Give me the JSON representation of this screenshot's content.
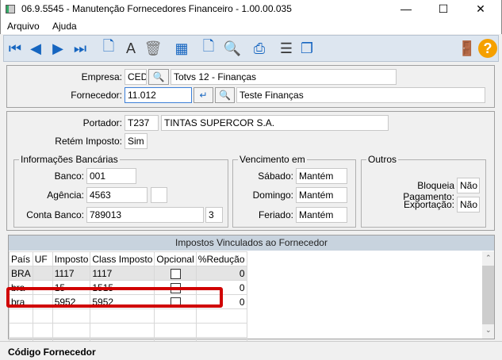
{
  "window": {
    "title": "06.9.5545 - Manutenção Fornecedores Financeiro - 1.00.00.035",
    "minimize": "—",
    "maximize": "☐",
    "close": "✕"
  },
  "menu": [
    "Arquivo",
    "Ajuda"
  ],
  "toolbar": [
    "first-icon",
    "previous-icon",
    "next-icon",
    "last-icon",
    "new-icon",
    "edit-icon",
    "delete-icon",
    "grid-icon",
    "blank-page-icon",
    "preview-icon",
    "print-icon",
    "filter-icon",
    "copy-icon",
    "exit-icon",
    "help-icon"
  ],
  "empresa": {
    "label": "Empresa:",
    "code": "CED",
    "name": "Totvs 12 - Finanças"
  },
  "fornecedor": {
    "label": "Fornecedor:",
    "code": "11.012",
    "name": "Teste Finanças"
  },
  "portador": {
    "label": "Portador:",
    "code": "T237",
    "name": "TINTAS SUPERCOR S.A."
  },
  "retem": {
    "label": "Retém Imposto:",
    "value": "Sim"
  },
  "bancarias": {
    "title": "Informações Bancárias",
    "banco_label": "Banco:",
    "banco": "001",
    "agencia_label": "Agência:",
    "agencia": "4563",
    "agencia_dv": "",
    "conta_label": "Conta Banco:",
    "conta": "789013",
    "conta_dv": "3"
  },
  "vencimento": {
    "title": "Vencimento em",
    "sabado_label": "Sábado:",
    "sabado": "Mantém",
    "domingo_label": "Domingo:",
    "domingo": "Mantém",
    "feriado_label": "Feriado:",
    "feriado": "Mantém"
  },
  "outros": {
    "title": "Outros",
    "bloqueia_label": "Bloqueia Pagamento:",
    "bloqueia": "Não",
    "exportacao_label": "Exportação:",
    "exportacao": "Não"
  },
  "grid": {
    "title": "Impostos Vinculados ao Fornecedor",
    "columns": [
      "País",
      "UF",
      "Imposto",
      "Class Imposto",
      "Opcional",
      "%Redução"
    ],
    "rows": [
      [
        "BRA",
        "",
        "1117",
        "1117",
        false,
        "0"
      ],
      [
        "bra",
        "",
        "15",
        "1515",
        false,
        "0"
      ],
      [
        "bra",
        "",
        "5952",
        "5952",
        false,
        "0"
      ]
    ],
    "highlight_color": "#d00000"
  },
  "status": "Código Fornecedor"
}
